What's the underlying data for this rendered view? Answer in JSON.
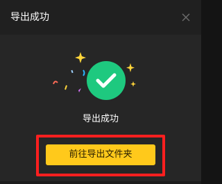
{
  "dialog": {
    "title": "导出成功",
    "close_icon": "close-icon",
    "success_icon": "check-circle-icon",
    "message": "导出成功",
    "open_folder_label": "前往导出文件夹"
  },
  "colors": {
    "accent_green": "#1ec97f",
    "primary_button": "#ffc91b",
    "highlight_border": "#ff1f1f",
    "background": "#262626",
    "titlebar": "#202020"
  }
}
